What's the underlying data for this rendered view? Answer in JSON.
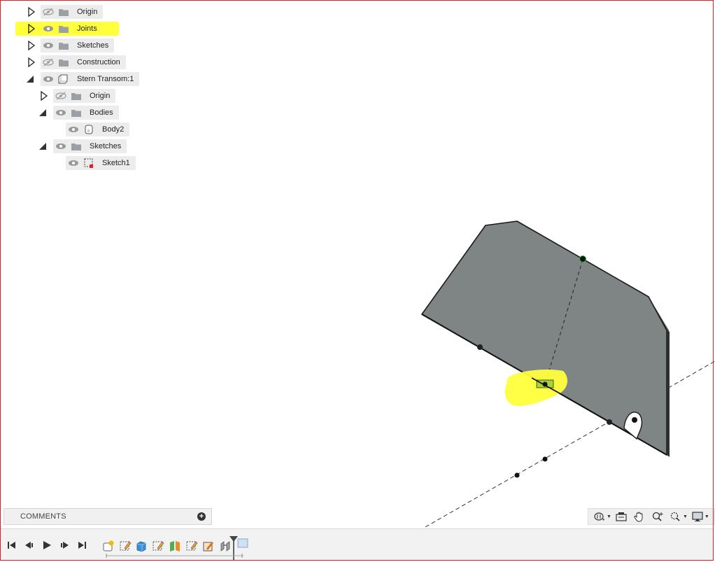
{
  "browser": {
    "items": [
      {
        "label": "Origin"
      },
      {
        "label": "Joints"
      },
      {
        "label": "Sketches"
      },
      {
        "label": "Construction"
      },
      {
        "label": "Stern Transom:1"
      },
      {
        "label": "Origin"
      },
      {
        "label": "Bodies"
      },
      {
        "label": "Body2"
      },
      {
        "label": "Sketches"
      },
      {
        "label": "Sketch1"
      }
    ]
  },
  "comments": {
    "label": "COMMENTS"
  },
  "navbar": {
    "icons": [
      "orbit-icon",
      "look-at-icon",
      "pan-icon",
      "zoom-icon",
      "fit-icon",
      "display-settings-icon"
    ]
  },
  "timeline": {
    "controls": [
      "go-to-start-icon",
      "step-back-icon",
      "play-icon",
      "step-forward-icon",
      "go-to-end-icon"
    ],
    "features": [
      "joint-origin",
      "sketch",
      "extrude",
      "sketch",
      "split",
      "sketch",
      "sketch",
      "joint",
      "marker"
    ]
  },
  "colors": {
    "highlight": "#ffff3c",
    "body_face": "#7f8584",
    "frame": "#dd2222"
  }
}
